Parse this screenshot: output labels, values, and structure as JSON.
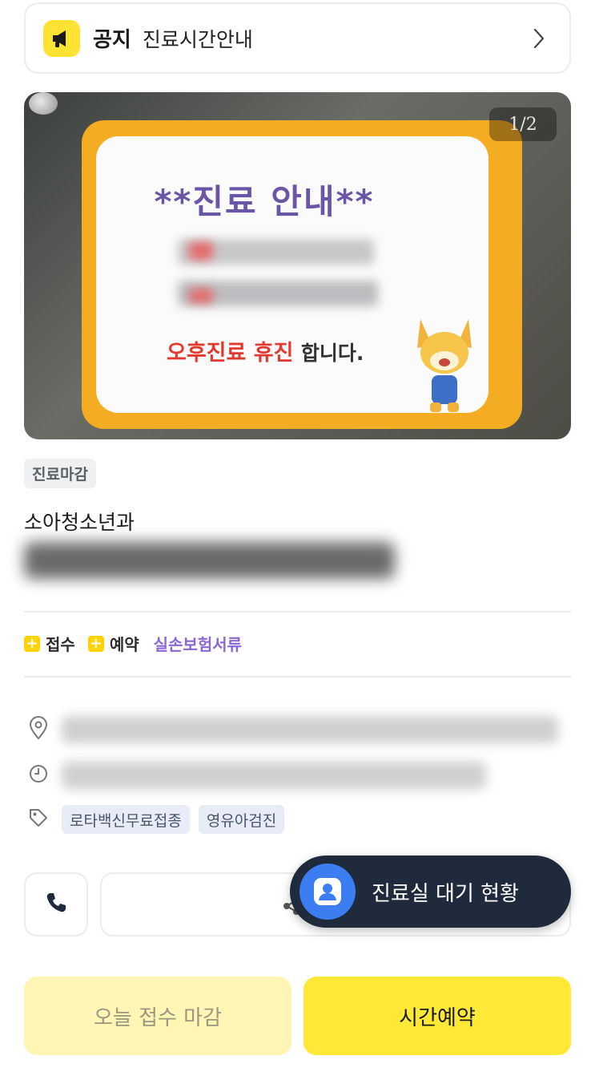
{
  "notice": {
    "tag": "공지",
    "text": "진료시간안내",
    "icon": "megaphone-icon",
    "chevron_icon": "chevron-right-icon"
  },
  "banner": {
    "counter": "1/2",
    "sign_title": "**진료 안내**",
    "sign_highlight": "오후진료 휴진",
    "sign_suffix": "합니다."
  },
  "clinic": {
    "status": "진료마감",
    "subject": "소아청소년과"
  },
  "features": {
    "reception_label": "접수",
    "reservation_label": "예약",
    "insurance_link": "실손보험서류"
  },
  "info": {
    "location_icon": "location-pin-icon",
    "hours_icon": "clock-icon",
    "tag_icon": "tag-icon",
    "tags": [
      "로타백신무료접종",
      "영유아검진"
    ]
  },
  "actions": {
    "call_icon": "phone-icon",
    "share_icon": "share-icon",
    "waiting_label": "진료실 대기 현황",
    "closed_label": "오늘 접수 마감",
    "reserve_label": "시간예약"
  },
  "colors": {
    "brand_yellow": "#ffe936",
    "accent_purple": "#8a66d6",
    "floating_bg": "#1f2a3d",
    "avatar_blue": "#3c7df1"
  }
}
